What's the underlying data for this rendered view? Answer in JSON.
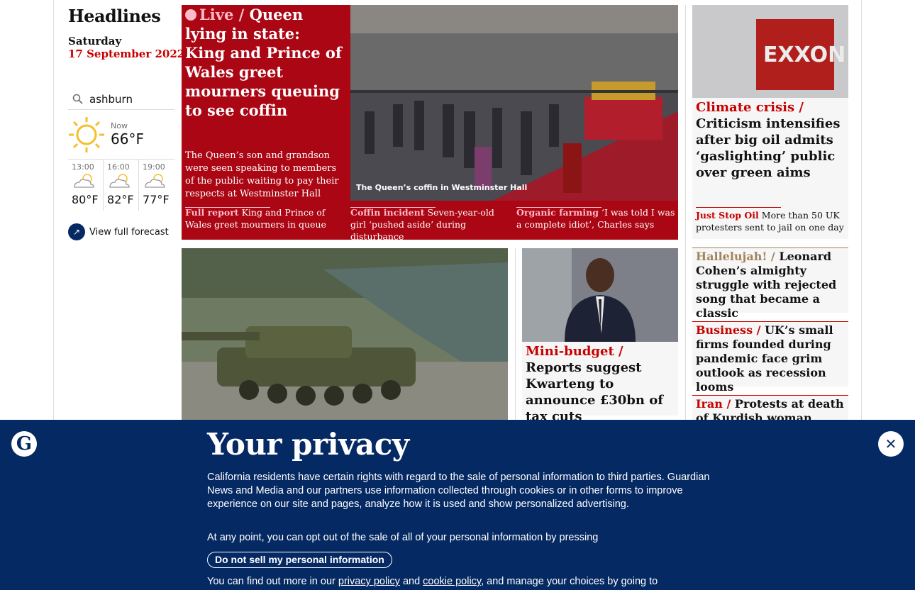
{
  "sidebar": {
    "title": "Headlines",
    "day": "Saturday",
    "date": "17 September 2022",
    "weather": {
      "location": "ashburn",
      "now_label": "Now",
      "now_temp": "66°F",
      "forecast": [
        {
          "time": "13:00",
          "temp": "80°F"
        },
        {
          "time": "16:00",
          "temp": "82°F"
        },
        {
          "time": "19:00",
          "temp": "77°F"
        }
      ],
      "full_forecast": "View full forecast"
    }
  },
  "live": {
    "kicker": "Live /",
    "headline": "Queen lying in state: King and Prince of Wales greet mourners queuing to see coffin",
    "standfirst": "The Queen’s son and grandson were seen speaking to members of the public waiting to pay their respects at Westminster Hall",
    "caption": "The Queen’s coffin in Westminster Hall",
    "sublinks": [
      {
        "kicker": "Full report",
        "text": "King and Prince of Wales greet mourners in queue"
      },
      {
        "kicker": "Coffin incident",
        "text": "Seven-year-old girl ‘pushed aside’ during disturbance"
      },
      {
        "kicker": "Organic farming",
        "text": "‘I was told I was a complete idiot’, Charles says"
      }
    ]
  },
  "mini_budget": {
    "kicker": "Mini-budget /",
    "headline": "Reports suggest Kwarteng to announce £30bn of tax cuts"
  },
  "climate": {
    "kicker": "Climate crisis /",
    "headline": "Criticism intensifies after big oil admits ‘gaslighting’ public over green aims",
    "sub_kicker": "Just Stop Oil",
    "sub_text": "More than 50 UK protesters sent to jail on one day",
    "image_sign": "EXXON"
  },
  "right_cards": [
    {
      "kicker": "Hallelujah! /",
      "headline": "Leonard Cohen’s almighty struggle with rejected song that became a classic",
      "style": "culture"
    },
    {
      "kicker": "Business /",
      "headline": "UK’s small firms founded during pandemic face grim outlook as recession looms",
      "style": "news"
    },
    {
      "kicker": "Iran /",
      "headline": "Protests at death of Kurdish woman after",
      "style": "news"
    }
  ],
  "privacy": {
    "logo": "G",
    "title": "Your privacy",
    "body": "California residents have certain rights with regard to the sale of personal information to third parties. Guardian News and Media and our partners use information collected through cookies or in other forms to improve experience on our site and pages, analyze how it is used and show personalized advertising.",
    "optout_text": "At any point, you can opt out of the sale of all of your personal information by pressing",
    "button": "Do not sell my personal information",
    "foot_pre": "You can find out more in our",
    "privacy_link": "privacy policy",
    "and": "and",
    "cookie_link": "cookie policy",
    "foot_post": ", and manage your choices by going to"
  },
  "colors": {
    "live_bg": "#ab0613",
    "news_red": "#c70000",
    "privacy_bg": "#052962",
    "culture": "#a1845c"
  }
}
